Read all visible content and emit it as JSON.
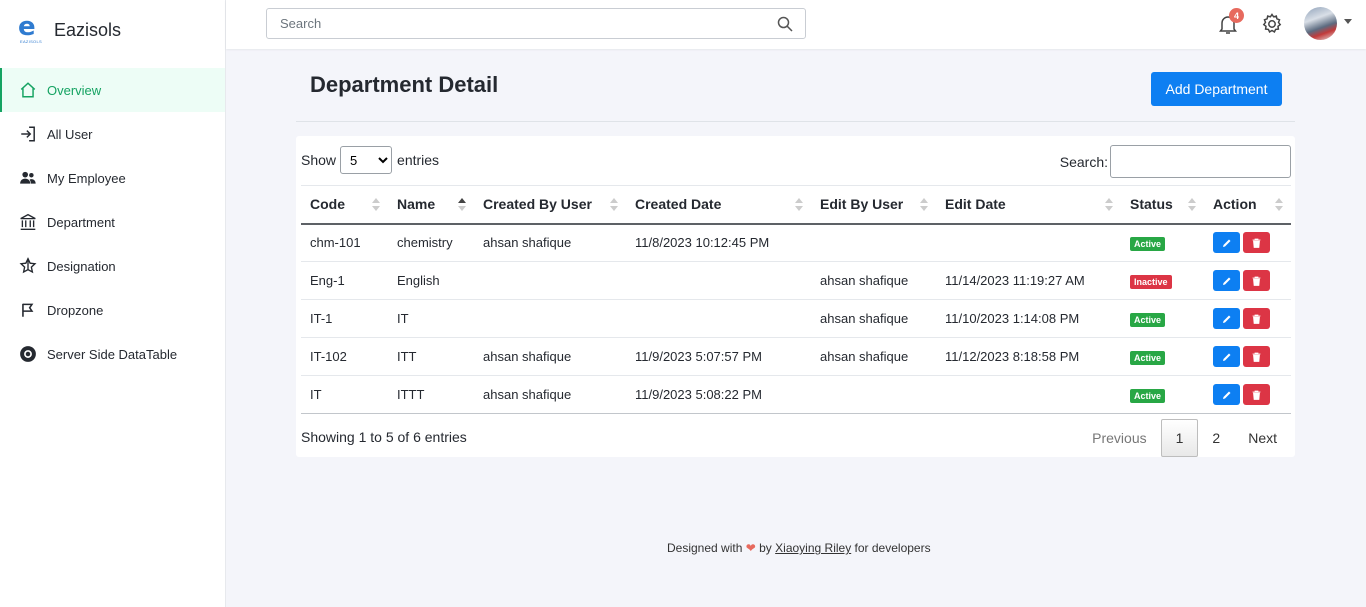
{
  "brand": {
    "logo_letter": "e",
    "logo_sub": "EAZISOLS",
    "name": "Eazisols"
  },
  "sidebar": {
    "items": [
      {
        "label": "Overview",
        "icon": "home-icon",
        "active": true
      },
      {
        "label": "All User",
        "icon": "login-icon",
        "active": false
      },
      {
        "label": "My Employee",
        "icon": "people-icon",
        "active": false
      },
      {
        "label": "Department",
        "icon": "bank-icon",
        "active": false
      },
      {
        "label": "Designation",
        "icon": "star-icon",
        "active": false
      },
      {
        "label": "Dropzone",
        "icon": "flag-icon",
        "active": false
      },
      {
        "label": "Server Side DataTable",
        "icon": "record-icon",
        "active": false
      }
    ]
  },
  "topbar": {
    "search_placeholder": "Search",
    "notification_count": "4"
  },
  "page": {
    "title": "Department Detail",
    "add_button": "Add Department"
  },
  "table_controls": {
    "show_label": "Show",
    "entries_value": "5",
    "entries_label": "entries",
    "search_label": "Search:"
  },
  "table": {
    "columns": [
      "Code",
      "Name",
      "Created By User",
      "Created Date",
      "Edit By User",
      "Edit Date",
      "Status",
      "Action"
    ],
    "rows": [
      {
        "code": "chm-101",
        "name": "chemistry",
        "created_by": "ahsan shafique",
        "created_date": "11/8/2023 10:12:45 PM",
        "edit_by": "",
        "edit_date": "",
        "status": "Active"
      },
      {
        "code": "Eng-1",
        "name": "English",
        "created_by": "",
        "created_date": "",
        "edit_by": "ahsan shafique",
        "edit_date": "11/14/2023 11:19:27 AM",
        "status": "Inactive"
      },
      {
        "code": "IT-1",
        "name": "IT",
        "created_by": "",
        "created_date": "",
        "edit_by": "ahsan shafique",
        "edit_date": "11/10/2023 1:14:08 PM",
        "status": "Active"
      },
      {
        "code": "IT-102",
        "name": "ITT",
        "created_by": "ahsan shafique",
        "created_date": "11/9/2023 5:07:57 PM",
        "edit_by": "ahsan shafique",
        "edit_date": "11/12/2023 8:18:58 PM",
        "status": "Active"
      },
      {
        "code": "IT",
        "name": "ITTT",
        "created_by": "ahsan shafique",
        "created_date": "11/9/2023 5:08:22 PM",
        "edit_by": "",
        "edit_date": "",
        "status": "Active"
      }
    ]
  },
  "pagination": {
    "info": "Showing 1 to 5 of 6 entries",
    "previous": "Previous",
    "pages": [
      "1",
      "2"
    ],
    "current": "1",
    "next": "Next"
  },
  "footer": {
    "prefix": "Designed with",
    "by": "by",
    "author": "Xiaoying Riley",
    "suffix": "for developers"
  },
  "colors": {
    "accent_green": "#15a362",
    "primary_blue": "#0d7ff2",
    "danger_red": "#dc3545",
    "success_green": "#28a745",
    "badge_red": "#e76a5e"
  }
}
